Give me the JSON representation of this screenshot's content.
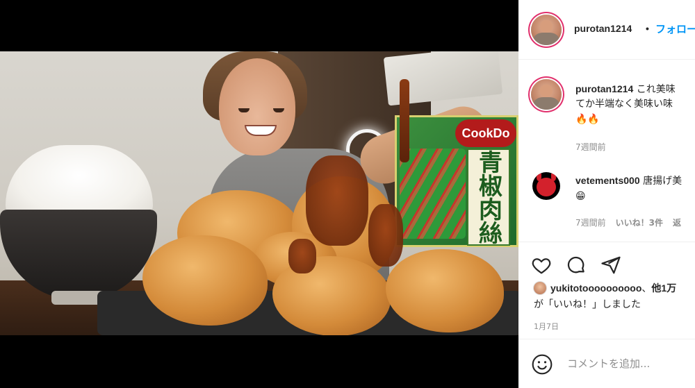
{
  "post": {
    "media_alt": "photo",
    "package": {
      "brand": "CookDo",
      "product_title": "青椒肉絲"
    }
  },
  "header": {
    "username": "purotan1214",
    "separator": "•",
    "follow_label": "フォロー"
  },
  "comments": [
    {
      "username": "purotan1214",
      "line1": "これ美味",
      "line2": "てか半端なく美味い味",
      "emoji": "🔥🔥",
      "time": "7週間前"
    },
    {
      "username": "vetements000",
      "text": "唐揚げ美",
      "emoji": "😁",
      "time": "7週間前",
      "likes": "いいね！3件",
      "reply": "返"
    }
  ],
  "likes": {
    "user": "yukitotoooooooooo",
    "suffix": "、",
    "others": "他1万",
    "line2": "が「いいね！」しました"
  },
  "date": "1月7日",
  "add_comment": {
    "placeholder": "コメントを追加..."
  },
  "icons": [
    "heart-icon",
    "comment-icon",
    "share-icon",
    "emoji-icon"
  ]
}
